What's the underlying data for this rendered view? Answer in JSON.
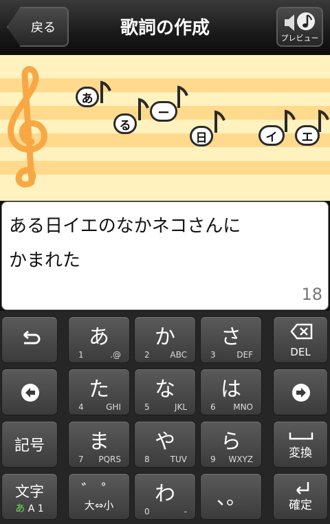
{
  "header": {
    "back_label": "戻る",
    "title": "歌詞の作成",
    "preview_label": "プレビュー"
  },
  "staff": {
    "notes": [
      "あ",
      "る",
      "ー",
      "日",
      "イ",
      "エ"
    ]
  },
  "lyrics": {
    "line1": "ある日イエのなかネコさんに",
    "line2": "かまれた",
    "char_count": "18"
  },
  "keyboard": {
    "row1": {
      "k1": {
        "main": "あ",
        "sub_l": "1",
        "sub_r": ".@"
      },
      "k2": {
        "main": "か",
        "sub_l": "2",
        "sub_r": "ABC"
      },
      "k3": {
        "main": "さ",
        "sub_l": "3",
        "sub_r": "DEF"
      },
      "del_label": "DEL"
    },
    "row2": {
      "k1": {
        "main": "た",
        "sub_l": "4",
        "sub_r": "GHI"
      },
      "k2": {
        "main": "な",
        "sub_l": "5",
        "sub_r": "JKL"
      },
      "k3": {
        "main": "は",
        "sub_l": "6",
        "sub_r": "MNO"
      }
    },
    "row3": {
      "kigou": "記号",
      "k1": {
        "main": "ま",
        "sub_l": "7",
        "sub_r": "PQRS"
      },
      "k2": {
        "main": "や",
        "sub_l": "8",
        "sub_r": "TUV"
      },
      "k3": {
        "main": "ら",
        "sub_l": "9",
        "sub_r": "WXYZ"
      },
      "henkan": "変換"
    },
    "row4": {
      "moji": "文字",
      "mode_a": "あ",
      "mode_rest": "A 1",
      "dakuten": "゛ ゜",
      "daishou": "大⇔小",
      "k2": {
        "main": "わ",
        "sub_l": "0",
        "sub_r": "-"
      },
      "punct": "、。",
      "kakutei": "確定"
    }
  },
  "colors": {
    "staff_bg": "#fff2bf",
    "staff_stripe": "#ffd98c",
    "clef": "#f7a845",
    "mode_accent": "#6fe05a"
  }
}
